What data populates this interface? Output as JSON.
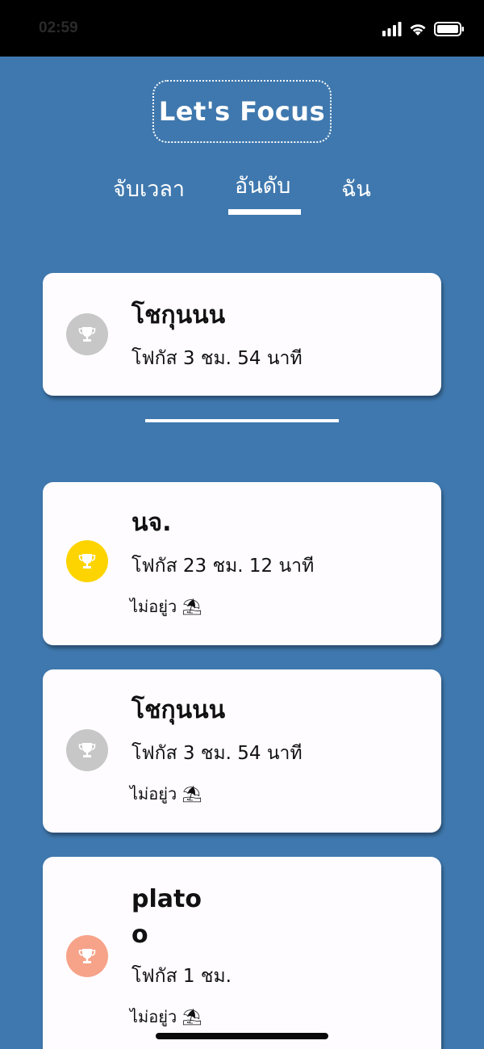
{
  "status_bar": {
    "time": "02:59"
  },
  "header": {
    "title": "Let's Focus"
  },
  "tabs": [
    {
      "label": "จับเวลา"
    },
    {
      "label": "อันดับ",
      "selected": true
    },
    {
      "label": "ฉัน"
    }
  ],
  "my_rank": {
    "name": "โชกุนนน",
    "focus": "โฟกัส 3 ชม. 54 นาที",
    "trophy_color": "#c7c7c7"
  },
  "leaderboard": [
    {
      "name": "นจ.",
      "focus": "โฟกัส 23 ชม. 12 นาที",
      "status": "ไม่อยู่ว",
      "status_icon": "umbrella-on-ground-emoji",
      "trophy_color": "#fdd400"
    },
    {
      "name": "โชกุนนน",
      "focus": "โฟกัส 3 ชม. 54 นาที",
      "status": "ไม่อยู่ว",
      "status_icon": "umbrella-on-ground-emoji",
      "trophy_color": "#c7c7c7"
    },
    {
      "name_line1": "plato",
      "name_line2": "o",
      "focus": "โฟกัส 1 ชม.",
      "status": "ไม่อยู่ว",
      "status_icon": "umbrella-on-ground-emoji",
      "trophy_color": "#f6a389"
    }
  ]
}
